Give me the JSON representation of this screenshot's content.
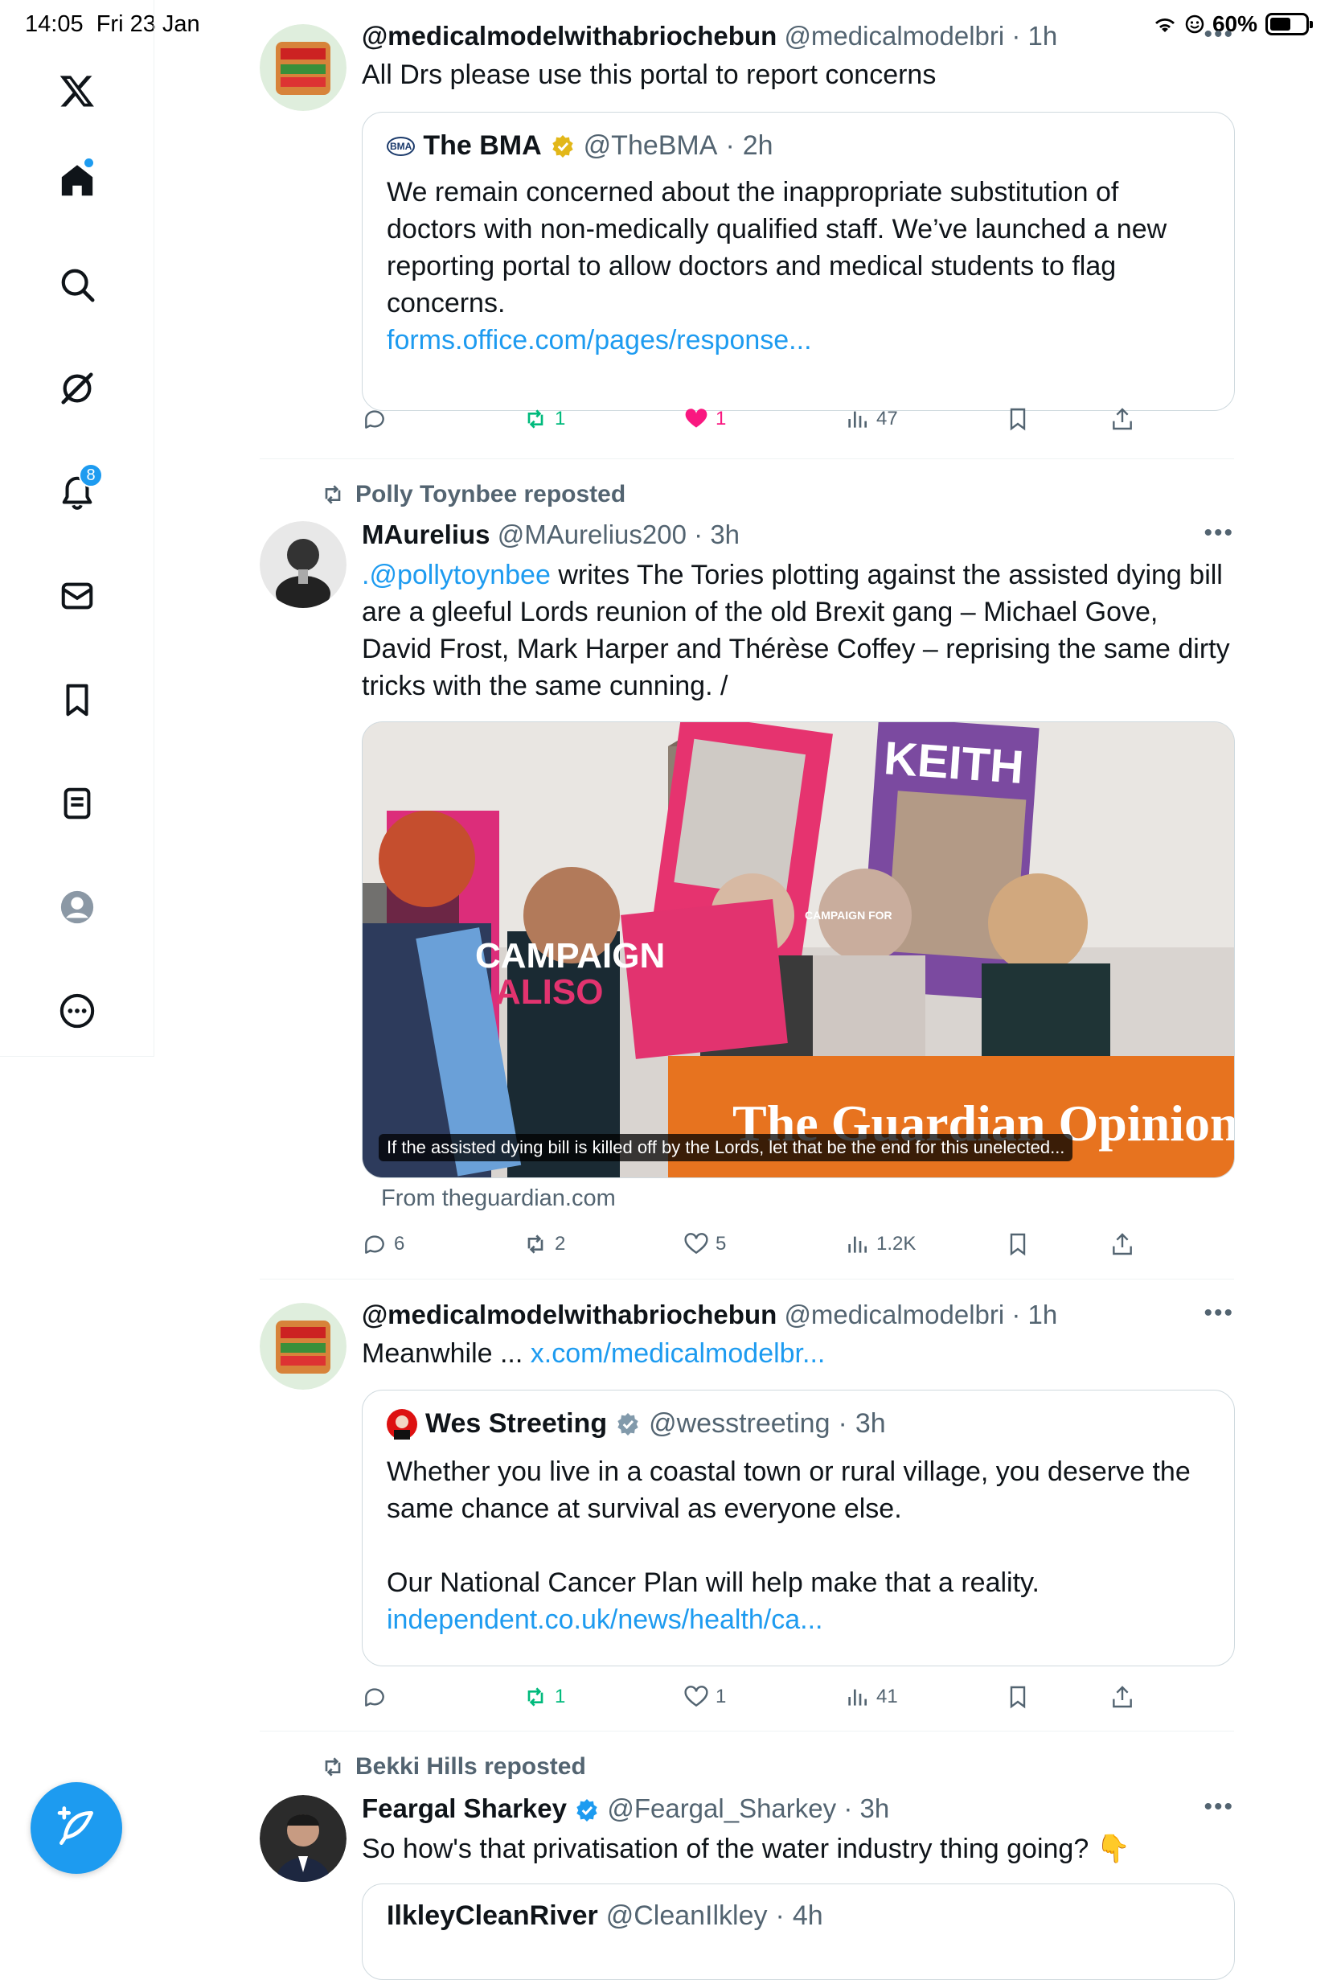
{
  "status": {
    "time": "14:05",
    "date": "Fri 23 Jan",
    "battery": "60%",
    "battery_level": 0.6
  },
  "sidebar": {
    "items": [
      {
        "name": "x-logo"
      },
      {
        "name": "home"
      },
      {
        "name": "search"
      },
      {
        "name": "grok"
      },
      {
        "name": "notifications"
      },
      {
        "name": "messages"
      },
      {
        "name": "bookmarks"
      },
      {
        "name": "lists"
      },
      {
        "name": "profile"
      },
      {
        "name": "more"
      }
    ],
    "notif_count": "8"
  },
  "posts": [
    {
      "name": "@medicalmodelwithabriochebun",
      "handle": "@medicalmodelbri",
      "time": "1h",
      "text": "All Drs please use this portal to report concerns",
      "quote": {
        "badge": "BMA",
        "name": "The BMA",
        "handle": "@TheBMA",
        "time": "2h",
        "text": "We remain concerned about the inappropriate substitution of doctors with non-medically qualified staff. We’ve launched a new reporting portal to allow doctors and medical students to flag concerns.",
        "link": "forms.office.com/pages/response..."
      },
      "actions": {
        "replies": "",
        "reposts": "1",
        "likes": "1",
        "views": "47"
      }
    },
    {
      "reposted_by": "Polly Toynbee reposted",
      "name": "MAurelius",
      "handle": "@MAurelius200",
      "time": "3h",
      "mention": ".@pollytoynbee",
      "text": " writes The Tories plotting against the assisted dying bill are a gleeful Lords reunion of the old Brexit gang – Michael Gove, David Frost, Mark Harper and Thérèse Coffey – reprising the same dirty tricks with the same cunning. /",
      "media": {
        "caption": "If the assisted dying bill is killed off by the Lords, let that be the end for this unelected...",
        "from": "From theguardian.com",
        "banner": "The Guardian Opinions",
        "sign1": "CAMPAIGN",
        "sign2": "ALISO",
        "sign3": "KEITH",
        "sign4": "CAMPAIGN FOR"
      },
      "actions": {
        "replies": "6",
        "reposts": "2",
        "likes": "5",
        "views": "1.2K"
      }
    },
    {
      "name": "@medicalmodelwithabriochebun",
      "handle": "@medicalmodelbri",
      "time": "1h",
      "text": "Meanwhile ... ",
      "link": "x.com/medicalmodelbr...",
      "quote": {
        "name": "Wes Streeting",
        "handle": "@wesstreeting",
        "time": "3h",
        "text1": "Whether you live in a coastal town or rural village, you deserve the same chance at survival as everyone else.",
        "text2": "Our National Cancer Plan will help make that a reality.",
        "link": "independent.co.uk/news/health/ca..."
      },
      "actions": {
        "replies": "",
        "reposts": "1",
        "likes": "1",
        "views": "41"
      }
    },
    {
      "reposted_by": "Bekki Hills reposted",
      "name": "Feargal Sharkey",
      "handle": "@Feargal_Sharkey",
      "time": "3h",
      "text": "So how's that privatisation of the water industry thing going? 👇",
      "quote_name": "IlkleyCleanRiver",
      "quote_handle": "@CleanIlkley",
      "quote_time": "4h"
    }
  ],
  "colors": {
    "accent": "#1d9bf0",
    "repost_green": "#00ba7c",
    "like_pink": "#f91880",
    "muted": "#536471"
  }
}
